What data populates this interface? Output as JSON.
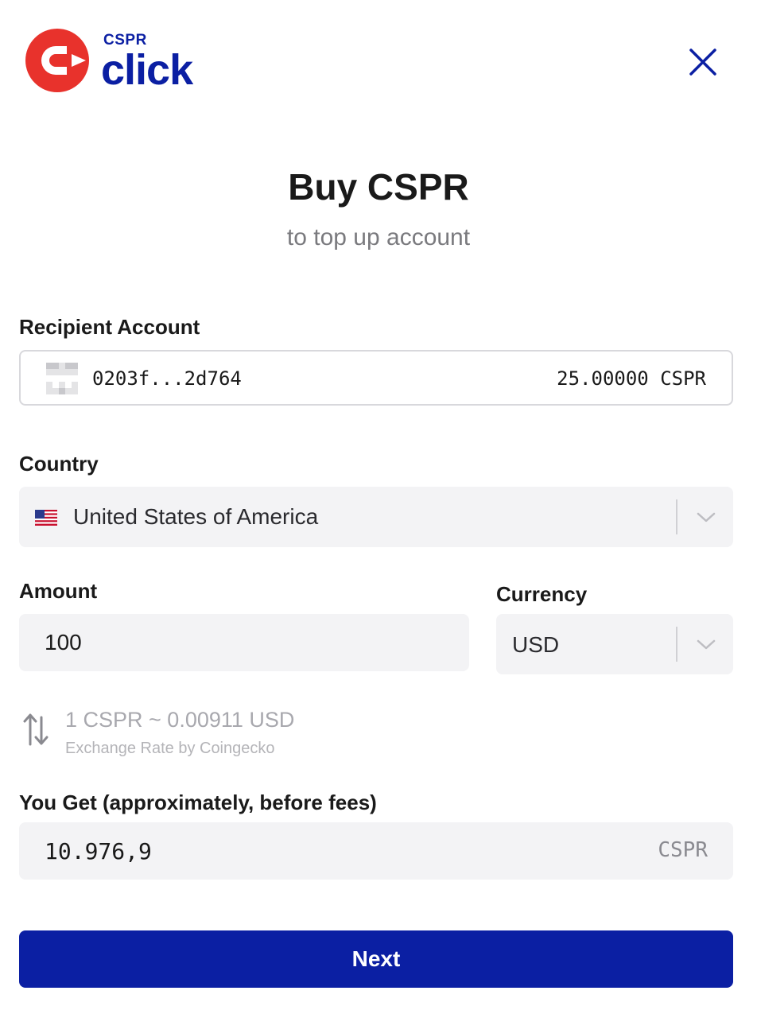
{
  "header": {
    "logo_small": "CSPR",
    "logo_big": "click",
    "brand_color": "#0b1fa3",
    "logo_color": "#e8322c"
  },
  "page": {
    "title": "Buy CSPR",
    "subtitle": "to top up account"
  },
  "recipient": {
    "label": "Recipient Account",
    "address": "0203f...2d764",
    "balance": "25.00000 CSPR"
  },
  "country": {
    "label": "Country",
    "value": "United States of America",
    "flag_icon": "us-flag-icon"
  },
  "amount": {
    "label": "Amount",
    "value": "100"
  },
  "currency": {
    "label": "Currency",
    "value": "USD"
  },
  "rate": {
    "text": "1 CSPR ~ 0.00911 USD",
    "source": "Exchange Rate by Coingecko"
  },
  "you_get": {
    "label": "You Get (approximately, before fees)",
    "value": "10.976,9",
    "unit": "CSPR"
  },
  "actions": {
    "next_label": "Next"
  }
}
